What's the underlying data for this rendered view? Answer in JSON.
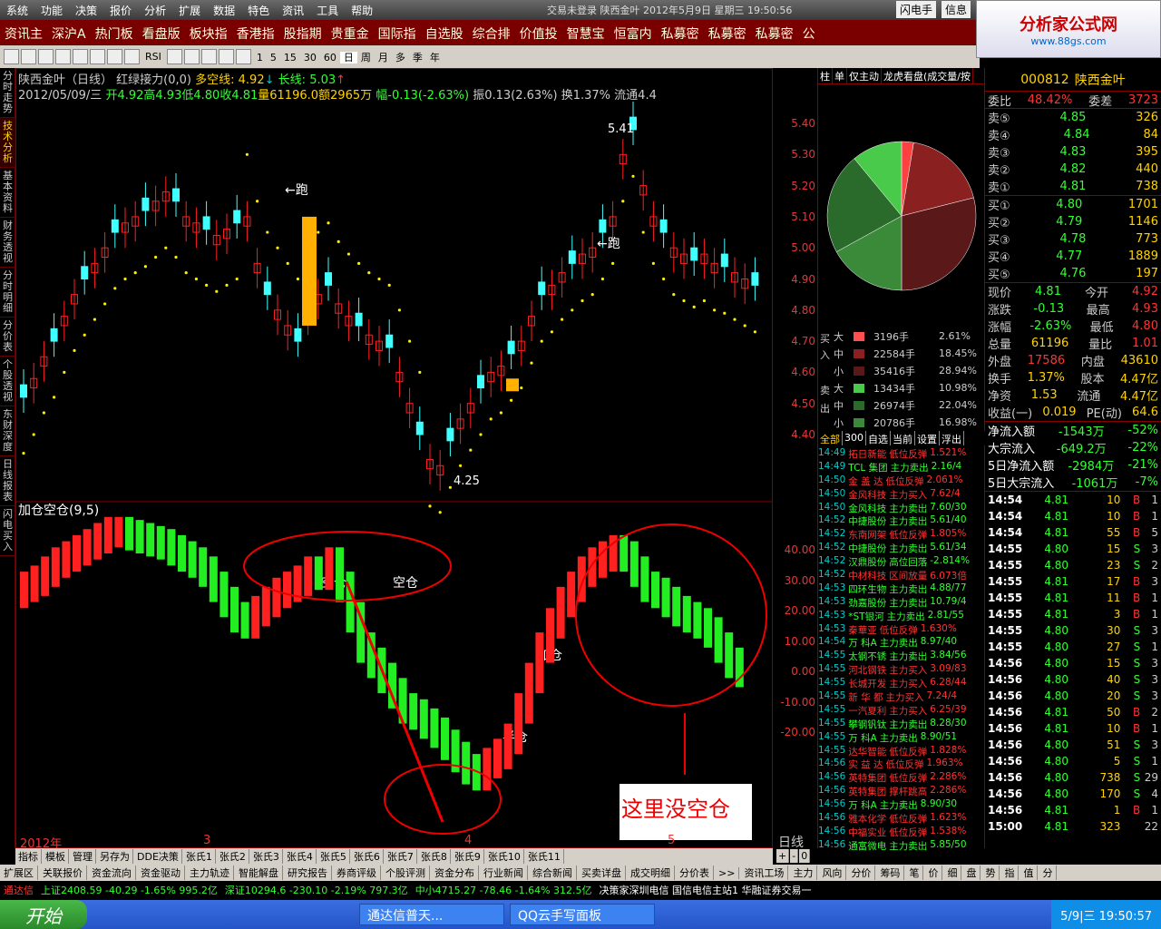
{
  "menubar": {
    "items": [
      "系统",
      "功能",
      "决策",
      "报价",
      "分析",
      "扩展",
      "数据",
      "特色",
      "资讯",
      "工具",
      "帮助"
    ],
    "title": "交易未登录  陕西金叶  2012年5月9日  星期三  19:50:56",
    "btns": [
      "闪电手",
      "信息"
    ]
  },
  "logo": {
    "text": "分析家公式网",
    "url": "www.88gs.com"
  },
  "tabs": [
    "资讯主",
    "深沪A",
    "热门板",
    "看盘版",
    "板块指",
    "香港指",
    "股指期",
    "贵重金",
    "国际指",
    "自选股",
    "综合排",
    "价值投",
    "智慧宝",
    "恒富内",
    "私募密",
    "私募密",
    "私募密",
    "公"
  ],
  "toolbar": {
    "periods": [
      "1",
      "5",
      "15",
      "30",
      "60",
      "日",
      "周",
      "月",
      "多",
      "季",
      "年"
    ],
    "items": [
      "RSI"
    ]
  },
  "sidenav": [
    "分时走势",
    "技术分析",
    "基本资料",
    "财务透视",
    "分时明细",
    "分价表",
    "个股透视",
    "东财深度",
    "日线报表",
    "闪电买入"
  ],
  "chart": {
    "hdr1": {
      "name": "陕西金叶（日线）",
      "ind": "红绿接力(0,0)",
      "dk": "多空线:",
      "dkv": "4.92",
      "dkarrow": "↓",
      "cx": "长线:",
      "cxv": "5.03",
      "cxarrow": "↑"
    },
    "hdr2": {
      "date": "2012/05/09/三",
      "o": "开4.92",
      "h": "高4.93",
      "l": "低4.80",
      "c": "收4.81",
      "vol": "量61196.0",
      "amt": "额2965万",
      "pct": "幅-0.13(-2.63%)",
      "amp": "振0.13(2.63%)",
      "turn": "换1.37%",
      "float": "流通4.4"
    },
    "ann_run1": "←跑",
    "ann_run2": "←跑",
    "ann_high": "5.41",
    "ann_low": "4.25",
    "sub_title": "加仓空仓(9,5)",
    "sub_ann": [
      "空仓",
      "空仓",
      "加仓",
      "半仓"
    ],
    "note": "这里没空仓",
    "xlabels": [
      "2012年",
      "3",
      "4",
      "5"
    ],
    "xlabel_right": "日线",
    "pm": [
      "+",
      "-",
      "0"
    ]
  },
  "axis_main": [
    "5.40",
    "5.30",
    "5.20",
    "5.10",
    "5.00",
    "4.90",
    "4.80",
    "4.70",
    "4.60",
    "4.50",
    "4.40"
  ],
  "axis_sub": [
    "40.00",
    "30.00",
    "20.00",
    "10.00",
    "0.00",
    "-10.00",
    "-20.00"
  ],
  "mid": {
    "tabs": [
      "柱",
      "单",
      "仅主动",
      "龙虎看盘(成交量/按"
    ],
    "buy_label": "买入",
    "sell_label": "卖出",
    "buy_rows": [
      {
        "s": "大",
        "v": "3196手",
        "p": "2.61%"
      },
      {
        "s": "中",
        "v": "22584手",
        "p": "18.45%"
      },
      {
        "s": "小",
        "v": "35416手",
        "p": "28.94%"
      }
    ],
    "sell_rows": [
      {
        "s": "大",
        "v": "13434手",
        "p": "10.98%"
      },
      {
        "s": "中",
        "v": "26974手",
        "p": "22.04%"
      },
      {
        "s": "小",
        "v": "20786手",
        "p": "16.98%"
      }
    ],
    "filter": [
      "全部",
      "300",
      "自选",
      "当前",
      "设置",
      "浮出"
    ],
    "ticks": [
      [
        "14:49",
        "拓日新能",
        "低位反弹",
        "1.521%"
      ],
      [
        "14:49",
        "TCL 集团",
        "主力卖出",
        "2.16/4"
      ],
      [
        "14:50",
        "金 盖 达",
        "低位反弹",
        "2.061%"
      ],
      [
        "14:50",
        "金风科技",
        "主力买入",
        "7.62/4"
      ],
      [
        "14:50",
        "金风科技",
        "主力卖出",
        "7.60/30"
      ],
      [
        "14:52",
        "中捷股份",
        "主力卖出",
        "5.61/40"
      ],
      [
        "14:52",
        "东南网架",
        "低位反弹",
        "1.805%"
      ],
      [
        "14:52",
        "中捷股份",
        "主力卖出",
        "5.61/34"
      ],
      [
        "14:52",
        "汉鼎股份",
        "高位回落",
        "-2.814%"
      ],
      [
        "14:52",
        "中材科技",
        "区间放量",
        "6.073倍"
      ],
      [
        "14:53",
        "四环生物",
        "主力卖出",
        "4.88/77"
      ],
      [
        "14:53",
        "劲嘉股份",
        "主力卖出",
        "10.79/4"
      ],
      [
        "14:53",
        "*ST银河",
        "主力卖出",
        "2.81/55"
      ],
      [
        "14:53",
        "秦華亚",
        "低位反弹",
        "1.630%"
      ],
      [
        "14:54",
        "万  科A",
        "主力卖出",
        "8.97/40"
      ],
      [
        "14:55",
        "太钢不锈",
        "主力卖出",
        "3.84/56"
      ],
      [
        "14:55",
        "河北钢铁",
        "主力买入",
        "3.09/83"
      ],
      [
        "14:55",
        "长城开发",
        "主力买入",
        "6.28/44"
      ],
      [
        "14:55",
        "新 华 都",
        "主力买入",
        "7.24/4"
      ],
      [
        "14:55",
        "一汽夏利",
        "主力买入",
        "6.25/39"
      ],
      [
        "14:55",
        "攀钢钒钛",
        "主力卖出",
        "8.28/30"
      ],
      [
        "14:55",
        "万  科A",
        "主力卖出",
        "8.90/51"
      ],
      [
        "14:55",
        "达华智能",
        "低位反弹",
        "1.828%"
      ],
      [
        "14:56",
        "实 益 达",
        "低位反弹",
        "1.963%"
      ],
      [
        "14:56",
        "英特集团",
        "低位反弹",
        "2.286%"
      ],
      [
        "14:56",
        "英特集团",
        "撑杆跳高",
        "2.286%"
      ],
      [
        "14:56",
        "万  科A",
        "主力卖出",
        "8.90/30"
      ],
      [
        "14:56",
        "雅本化学",
        "低位反弹",
        "1.623%"
      ],
      [
        "14:56",
        "中福实业",
        "低位反弹",
        "1.538%"
      ],
      [
        "14:56",
        "通富微电",
        "主力卖出",
        "5.85/50"
      ]
    ]
  },
  "quote": {
    "code": "000812",
    "name": "陕西金叶",
    "wb": {
      "l": "委比",
      "v": "48.42%",
      "l2": "委差",
      "v2": "3723"
    },
    "sells": [
      [
        "卖⑤",
        "4.85",
        "326"
      ],
      [
        "卖④",
        "4.84",
        "84"
      ],
      [
        "卖③",
        "4.83",
        "395"
      ],
      [
        "卖②",
        "4.82",
        "440"
      ],
      [
        "卖①",
        "4.81",
        "738"
      ]
    ],
    "buys": [
      [
        "买①",
        "4.80",
        "1701"
      ],
      [
        "买②",
        "4.79",
        "1146"
      ],
      [
        "买③",
        "4.78",
        "773"
      ],
      [
        "买④",
        "4.77",
        "1889"
      ],
      [
        "买⑤",
        "4.76",
        "197"
      ]
    ],
    "stats": [
      [
        "现价",
        "4.81",
        "今开",
        "4.92"
      ],
      [
        "涨跌",
        "-0.13",
        "最高",
        "4.93"
      ],
      [
        "涨幅",
        "-2.63%",
        "最低",
        "4.80"
      ],
      [
        "总量",
        "61196",
        "量比",
        "1.01"
      ],
      [
        "外盘",
        "17586",
        "内盘",
        "43610"
      ],
      [
        "换手",
        "1.37%",
        "股本",
        "4.47亿"
      ],
      [
        "净资",
        "1.53",
        "流通",
        "4.47亿"
      ],
      [
        "收益(一)",
        "0.019",
        "PE(动)",
        "64.6"
      ]
    ],
    "flows": [
      [
        "净流入额",
        "-1543万",
        "-52%"
      ],
      [
        "大宗流入",
        "-649.2万",
        "-22%"
      ],
      [
        "5日净流入额",
        "-2984万",
        "-21%"
      ],
      [
        "5日大宗流入",
        "-1061万",
        "-7%"
      ]
    ],
    "trades": [
      [
        "14:54",
        "4.81",
        "10",
        "B",
        "1"
      ],
      [
        "14:54",
        "4.81",
        "10",
        "B",
        "1"
      ],
      [
        "14:54",
        "4.81",
        "55",
        "B",
        "5"
      ],
      [
        "14:55",
        "4.80",
        "15",
        "S",
        "3"
      ],
      [
        "14:55",
        "4.80",
        "23",
        "S",
        "2"
      ],
      [
        "14:55",
        "4.81",
        "17",
        "B",
        "3"
      ],
      [
        "14:55",
        "4.81",
        "11",
        "B",
        "1"
      ],
      [
        "14:55",
        "4.81",
        "3",
        "B",
        "1"
      ],
      [
        "14:55",
        "4.80",
        "30",
        "S",
        "3"
      ],
      [
        "14:55",
        "4.80",
        "27",
        "S",
        "1"
      ],
      [
        "14:56",
        "4.80",
        "15",
        "S",
        "3"
      ],
      [
        "14:56",
        "4.80",
        "40",
        "S",
        "3"
      ],
      [
        "14:56",
        "4.80",
        "20",
        "S",
        "3"
      ],
      [
        "14:56",
        "4.81",
        "50",
        "B",
        "2"
      ],
      [
        "14:56",
        "4.81",
        "10",
        "B",
        "1"
      ],
      [
        "14:56",
        "4.80",
        "51",
        "S",
        "3"
      ],
      [
        "14:56",
        "4.80",
        "5",
        "S",
        "1"
      ],
      [
        "14:56",
        "4.80",
        "738",
        "S",
        "29"
      ],
      [
        "14:56",
        "4.80",
        "170",
        "S",
        "4"
      ],
      [
        "14:56",
        "4.81",
        "1",
        "B",
        "1"
      ],
      [
        "15:00",
        "4.81",
        "323",
        "",
        "22"
      ]
    ]
  },
  "btabs": [
    "指标",
    "模板",
    "管理",
    "另存为",
    "DDE决策",
    "张氏1",
    "张氏2",
    "张氏3",
    "张氏4",
    "张氏5",
    "张氏6",
    "张氏7",
    "张氏8",
    "张氏9",
    "张氏10",
    "张氏11"
  ],
  "btabs2": [
    "扩展区",
    "关联报价",
    "资金流向",
    "资金驱动",
    "主力轨迹",
    "智能解盘",
    "研究报告",
    "券商评级",
    "个股评测",
    "资金分布",
    "行业新闻",
    "综合新闻",
    "买卖详盘",
    "成交明细",
    "分价表",
    ">>",
    "资讯工场",
    "主力",
    "风向",
    "分价",
    "筹码",
    "笔",
    "价",
    "细",
    "盘",
    "势",
    "指",
    "值",
    "分"
  ],
  "status": {
    "sh": "上证2408.59  -40.29  -1.65%  995.2亿",
    "sz": "深证10294.6  -230.10  -2.19%  797.3亿",
    "zx": "中小4715.27  -78.46  -1.64%  312.5亿",
    "app": "通达信",
    "srv": "决策家深圳电信  国信电信主站1  华融证券交易一"
  },
  "taskbar": {
    "start": "开始",
    "tasks": [
      "通达信普天...",
      "QQ云手写面板"
    ],
    "time": "5/9|三 19:50:57"
  },
  "colors": {
    "up": "#ff2020",
    "down": "#40ffff",
    "greenbar": "#22ee22",
    "dot": "#ffee00",
    "accent": "#ffd400"
  }
}
